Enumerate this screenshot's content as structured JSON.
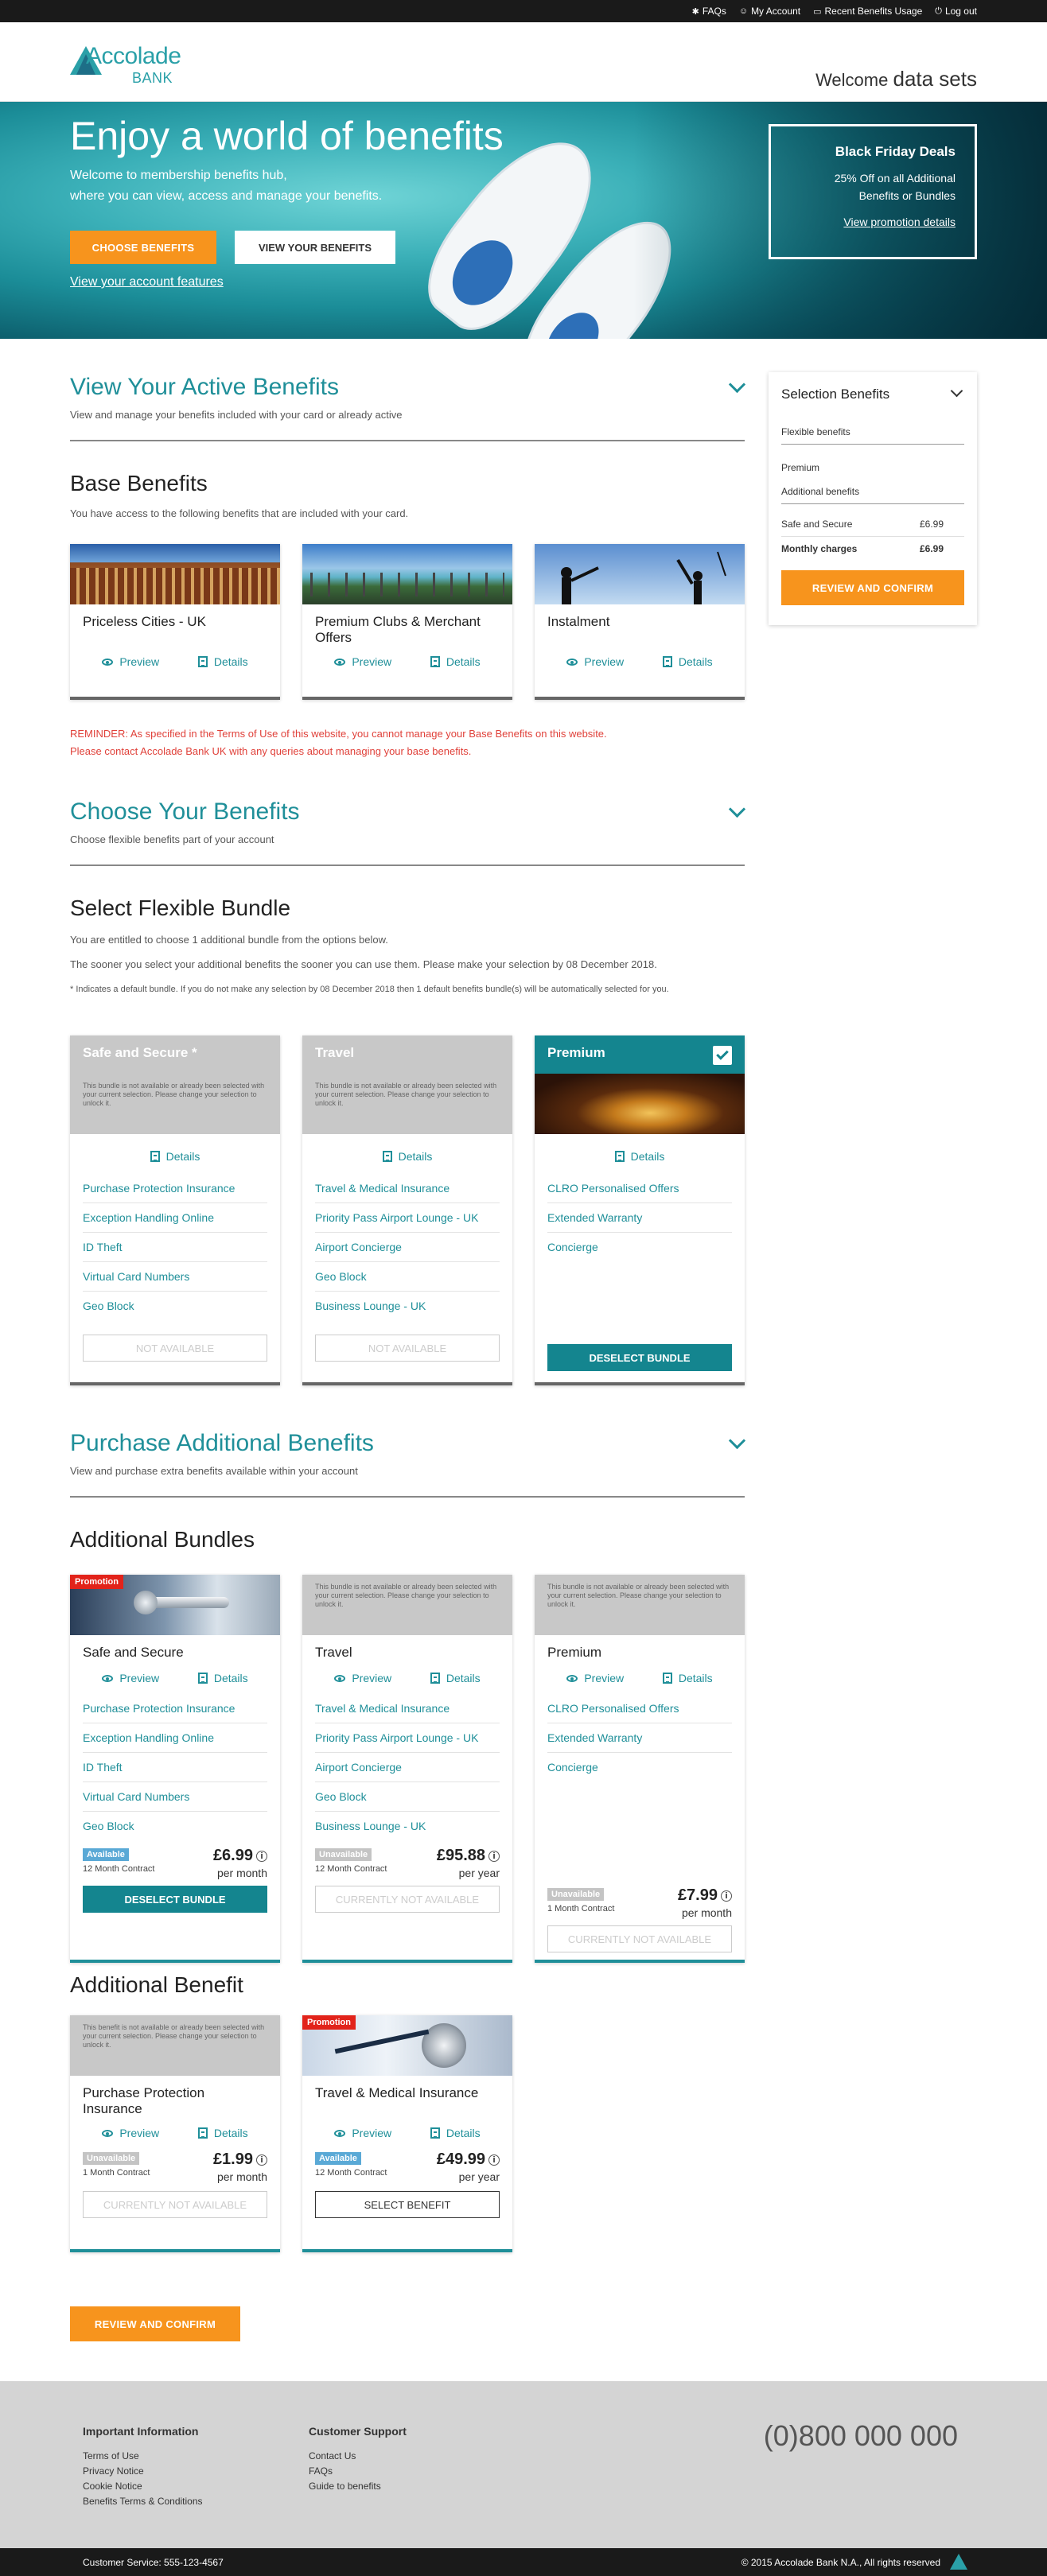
{
  "topbar": {
    "faqs": "FAQs",
    "account": "My Account",
    "usage": "Recent Benefits Usage",
    "logout": "Log out"
  },
  "header": {
    "brand_main": "Accolade",
    "brand_sub": "BANK",
    "welcome": "Welcome",
    "user": "data sets"
  },
  "hero": {
    "title": "Enjoy a world of benefits",
    "subtitle_1": "Welcome to membership benefits hub,",
    "subtitle_2": "where you can view, access and manage your benefits.",
    "choose_btn": "CHOOSE BENEFITS",
    "view_btn": "VIEW YOUR BENEFITS",
    "account_link": "View your account features",
    "promo": {
      "title": "Black Friday Deals",
      "desc_1": "25% Off on all Additional",
      "desc_2": "Benefits or Bundles",
      "link": "View promotion details"
    }
  },
  "active": {
    "title": "View Your Active Benefits",
    "desc": "View and manage your benefits included with your card or already active"
  },
  "base": {
    "title": "Base Benefits",
    "desc": "You have access to the following benefits that are included with your card.",
    "cards": [
      {
        "title": "Priceless Cities - UK"
      },
      {
        "title": "Premium Clubs & Merchant Offers"
      },
      {
        "title": "Instalment"
      }
    ],
    "preview": "Preview",
    "details": "Details",
    "reminder_1": "REMINDER: As specified in the Terms of Use of this website, you cannot manage your Base Benefits on this website.",
    "reminder_2": "Please contact Accolade Bank UK with any queries about managing your base benefits."
  },
  "choose": {
    "title": "Choose Your Benefits",
    "desc": "Choose flexible benefits part of your account"
  },
  "flex": {
    "title": "Select Flexible Bundle",
    "desc_1": "You are entitled to choose 1 additional bundle from the options below.",
    "desc_2": "The sooner you select your additional benefits the sooner you can use them. Please make your selection by 08 December 2018.",
    "desc_3": "* Indicates a default bundle. If you do not make any selection by 08 December 2018 then 1 default benefits bundle(s) will be automatically selected for you.",
    "locked_note": "This bundle is not available or already been selected with your current selection. Please change your selection to unlock it.",
    "bundles": [
      {
        "name": "Safe and Secure *",
        "items": [
          "Purchase Protection Insurance",
          "Exception Handling Online",
          "ID Theft",
          "Virtual Card Numbers",
          "Geo Block"
        ],
        "button": "NOT AVAILABLE"
      },
      {
        "name": "Travel",
        "items": [
          "Travel & Medical Insurance",
          "Priority Pass Airport Lounge - UK",
          "Airport Concierge",
          "Geo Block",
          "Business Lounge - UK"
        ],
        "button": "NOT AVAILABLE"
      },
      {
        "name": "Premium",
        "items": [
          "CLRO Personalised Offers",
          "Extended Warranty",
          "Concierge"
        ],
        "button": "DESELECT BUNDLE"
      }
    ],
    "details": "Details"
  },
  "purchase": {
    "title": "Purchase Additional Benefits",
    "desc": "View and purchase extra benefits available within your account"
  },
  "add_bundles": {
    "title": "Additional Bundles",
    "promo": "Promotion",
    "bundles": [
      {
        "name": "Safe and Secure",
        "items": [
          "Purchase Protection Insurance",
          "Exception Handling Online",
          "ID Theft",
          "Virtual Card Numbers",
          "Geo Block"
        ],
        "status": "Available",
        "contract": "12 Month Contract",
        "price": "£6.99",
        "per": "per month",
        "button": "DESELECT BUNDLE"
      },
      {
        "name": "Travel",
        "items": [
          "Travel & Medical Insurance",
          "Priority Pass Airport Lounge - UK",
          "Airport Concierge",
          "Geo Block",
          "Business Lounge - UK"
        ],
        "status": "Unavailable",
        "contract": "12 Month Contract",
        "price": "£95.88",
        "per": "per year",
        "button": "CURRENTLY NOT AVAILABLE"
      },
      {
        "name": "Premium",
        "items": [
          "CLRO Personalised Offers",
          "Extended Warranty",
          "Concierge"
        ],
        "status": "Unavailable",
        "contract": "1 Month Contract",
        "price": "£7.99",
        "per": "per month",
        "button": "CURRENTLY NOT AVAILABLE"
      }
    ]
  },
  "add_benefit": {
    "title": "Additional Benefit",
    "locked_note": "This benefit is not available or already been selected with your current selection. Please change your selection to unlock it.",
    "items": [
      {
        "name": "Purchase Protection Insurance",
        "status": "Unavailable",
        "contract": "1 Month Contract",
        "price": "£1.99",
        "per": "per month",
        "button": "CURRENTLY NOT AVAILABLE"
      },
      {
        "name": "Travel & Medical Insurance",
        "status": "Available",
        "contract": "12 Month Contract",
        "price": "£49.99",
        "per": "per year",
        "button": "SELECT BENEFIT"
      }
    ]
  },
  "review_btn": "REVIEW AND CONFIRM",
  "sidebar": {
    "title": "Selection Benefits",
    "flexible": "Flexible benefits",
    "premium": "Premium",
    "additional": "Additional benefits",
    "item_name": "Safe and Secure",
    "item_price": "£6.99",
    "total_label": "Monthly charges",
    "total": "£6.99",
    "button": "REVIEW AND CONFIRM"
  },
  "footer": {
    "info_title": "Important Information",
    "info_links": [
      "Terms of Use",
      "Privacy Notice",
      "Cookie Notice",
      "Benefits Terms & Conditions"
    ],
    "support_title": "Customer Support",
    "support_links": [
      "Contact Us",
      "FAQs",
      "Guide to benefits"
    ],
    "phone": "(0)800 000 000",
    "service": "Customer Service: 555-123-4567",
    "copyright": "© 2015 Accolade Bank N.A., All rights reserved"
  },
  "colors": {
    "teal": "#1f8f99",
    "orange": "#f7941d",
    "red": "#e2231a"
  }
}
